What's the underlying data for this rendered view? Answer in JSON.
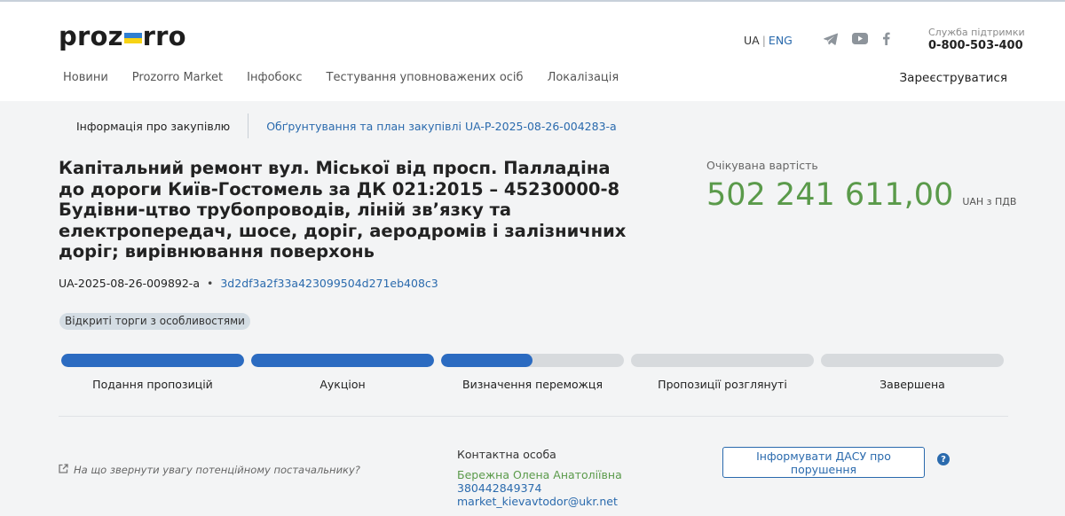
{
  "header": {
    "logo_left": "proz",
    "logo_right": "rro",
    "lang_ua": "UA",
    "lang_sep": "|",
    "lang_eng": "ENG",
    "support_label": "Служба підтримки",
    "support_phone": "0-800-503-400",
    "nav": [
      "Новини",
      "Prozorro Market",
      "Інфобокс",
      "Тестування уповноважених осіб",
      "Локалізація"
    ],
    "register": "Зареєструватися"
  },
  "tabs": {
    "info": "Інформація про закупівлю",
    "plan": "Обґрунтування та план закупівлі UA-P-2025-08-26-004283-a"
  },
  "tender": {
    "title": "Капітальний ремонт вул. Міської від просп. Палладіна до дороги Київ-Гостомель за ДК 021:2015 – 45230000-8 Будівни-цтво трубопроводів, ліній зв’язку та електропередач, шосе, доріг, аеродромів і залізничних доріг; вирівнювання поверхонь",
    "id": "UA-2025-08-26-009892-a",
    "hash": "3d2df3a2f33a423099504d271eb408c3",
    "procedure": "Відкриті торги з особливостями"
  },
  "expected": {
    "label": "Очікувана вартість",
    "value": "502 241 611,00",
    "currency": "UAH з ПДВ"
  },
  "steps": [
    {
      "label": "Подання пропозицій",
      "progress": 1
    },
    {
      "label": "Аукціон",
      "progress": 1
    },
    {
      "label": "Визначення переможця",
      "progress": 0.5
    },
    {
      "label": "Пропозиції розглянуті",
      "progress": 0
    },
    {
      "label": "Завершена",
      "progress": 0
    }
  ],
  "footer": {
    "hint": "На що звернути увагу потенційному постачальнику?",
    "contact_label": "Контактна особа",
    "contact_name": "Бережна Олена Анатоліївна",
    "contact_phone": "380442849374",
    "contact_email": "market_kievavtodor@ukr.net",
    "notify_button": "Інформувати ДАСУ про порушення",
    "help": "?"
  },
  "colors": {
    "accent": "#2a6aad",
    "progress": "#2b6bc1",
    "price": "#5a9a4a",
    "flag_blue": "#2f7fd1",
    "flag_yellow": "#f7d315"
  },
  "icons": [
    "telegram-icon",
    "youtube-icon",
    "facebook-icon",
    "external-link-icon",
    "help-icon"
  ]
}
